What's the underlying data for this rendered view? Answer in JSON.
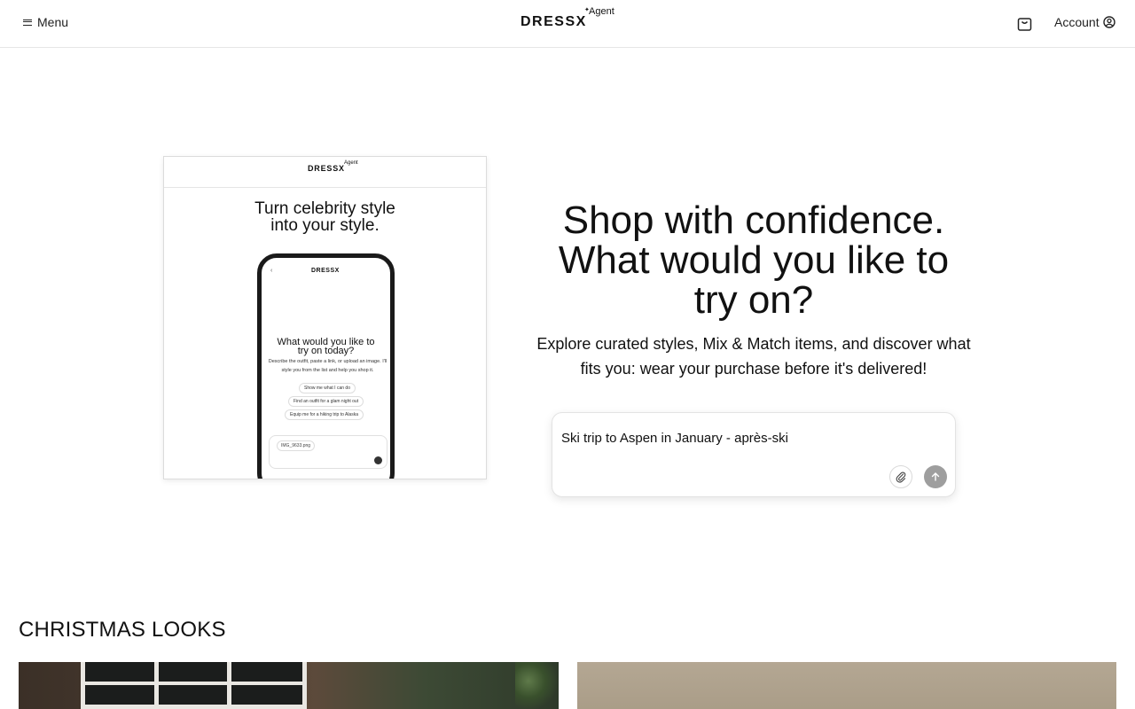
{
  "header": {
    "menu_label": "Menu",
    "logo_text": "DRESSX",
    "logo_suffix": "Agent",
    "account_label": "Account"
  },
  "preview": {
    "logo_text": "DRESSX",
    "logo_suffix": "Agent",
    "headline": "Turn celebrity style into your style.",
    "phone": {
      "logo_text": "DRESSX",
      "question": "What would you like to try on today?",
      "subtext": "Describe the outfit, paste a link, or upload an image. I'll style you from the list and help you shop it.",
      "chips": [
        "Show me what I can do",
        "Find an outfit for a glam night out",
        "Equip me for a hiking trip to Alaska"
      ],
      "tag": "IMG_9633.png"
    }
  },
  "hero": {
    "title": "Shop with confidence. What would you like to try on?",
    "subtitle": "Explore curated styles, Mix & Match items, and discover what fits you: wear your purchase before it's delivered!"
  },
  "prompt": {
    "value": "Ski trip to Aspen in January - après-ski"
  },
  "section": {
    "title": "CHRISTMAS LOOKS"
  }
}
